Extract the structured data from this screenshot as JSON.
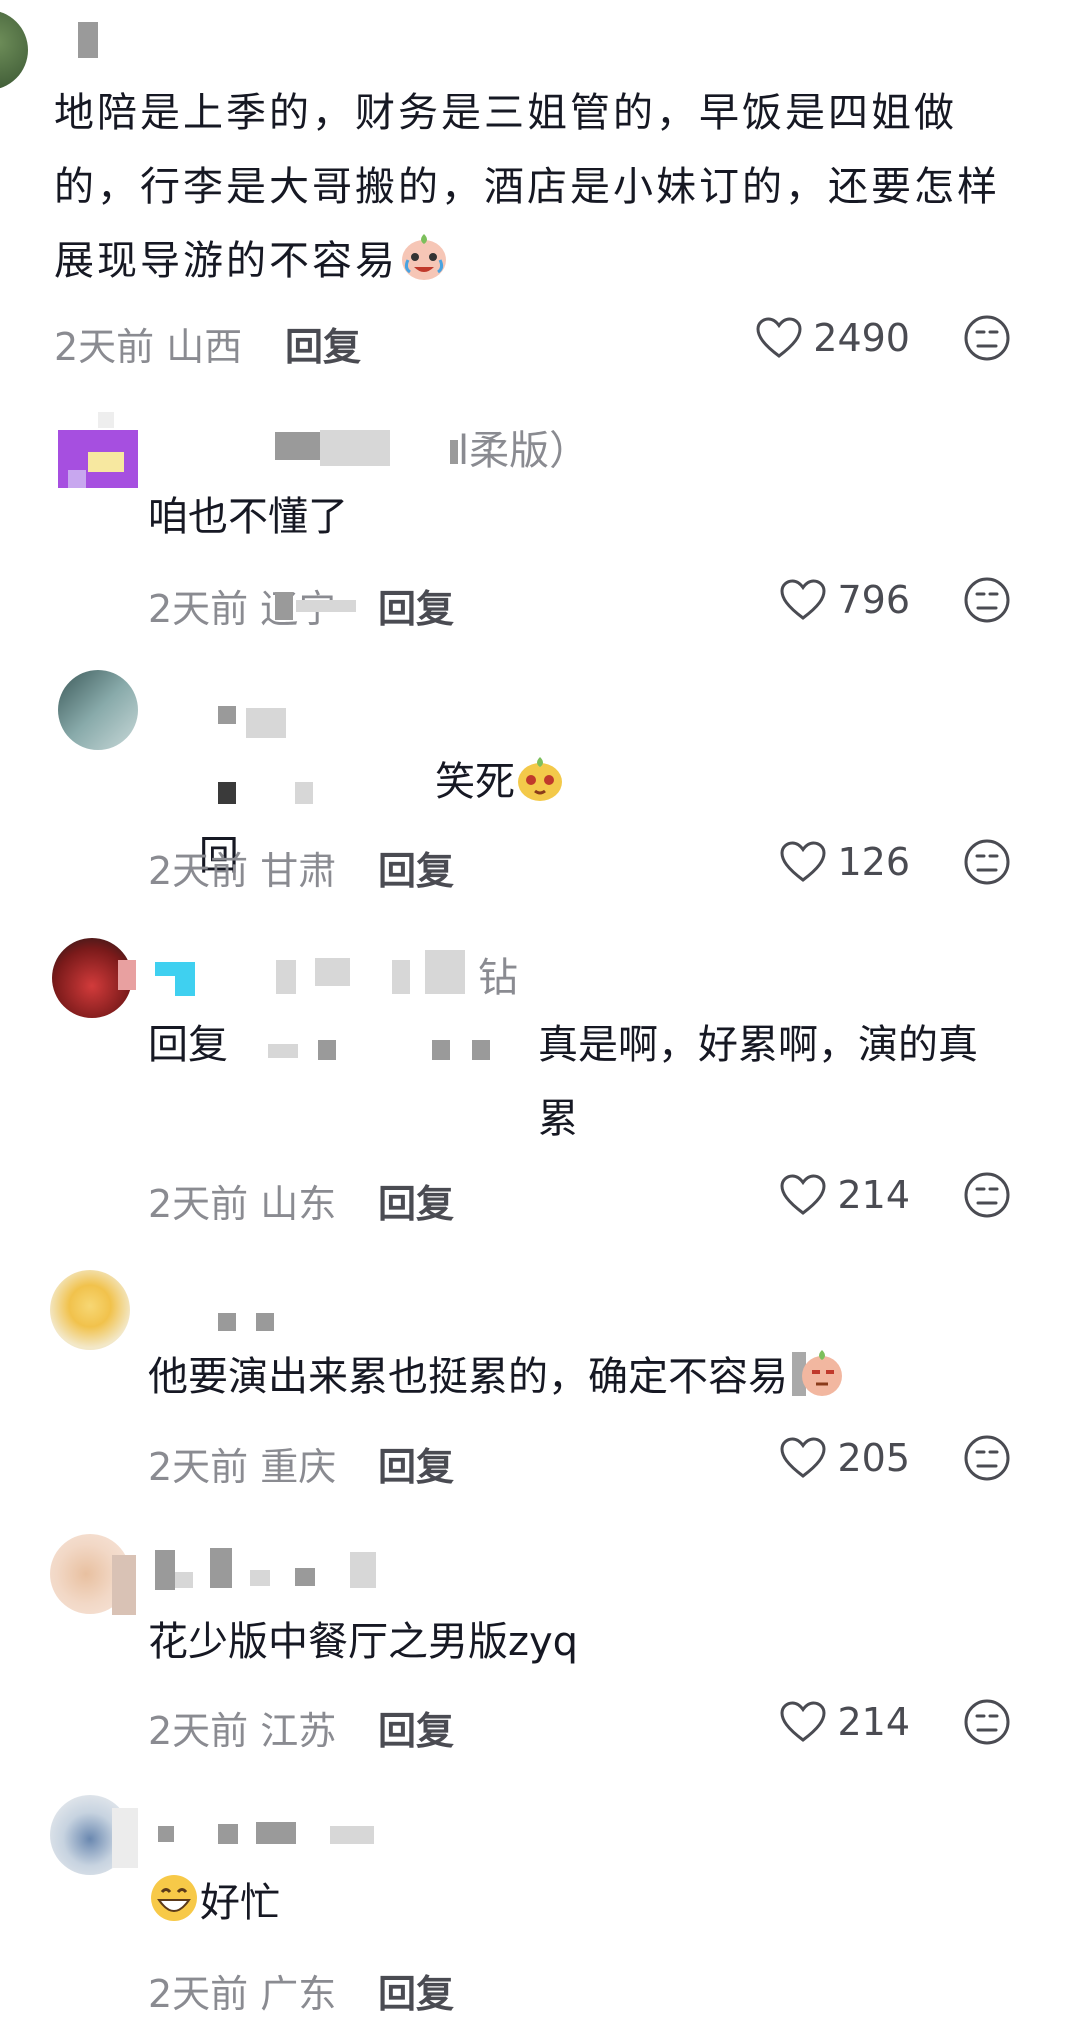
{
  "comments": [
    {
      "text": "地陪是上季的，财务是三姐管的，早饭是四姐做的，行李是大哥搬的，酒店是小妹订的，还要怎样展现导游的不容易",
      "time": "2天前 山西",
      "reply": "回复",
      "likes": "2490"
    },
    {
      "name_suffix": "l柔版）",
      "text": "咱也不懂了",
      "time": "2天前 辽宁",
      "reply": "回复",
      "likes": "796"
    },
    {
      "text_prefix": "回",
      "text": "笑死",
      "time": "2天前 甘肃",
      "reply": "回复",
      "likes": "126"
    },
    {
      "name_suffix": "钻",
      "text_prefix": "回复",
      "text": "真是啊，好累啊，演的真累",
      "time": "2天前 山东",
      "reply": "回复",
      "likes": "214"
    },
    {
      "text": "他要演出来累也挺累的，确定不容易",
      "time": "2天前 重庆",
      "reply": "回复",
      "likes": "205"
    },
    {
      "text": "花少版中餐厅之男版zyq",
      "time": "2天前 江苏",
      "reply": "回复",
      "likes": "214"
    },
    {
      "text": "好忙",
      "time": "2天前 广东",
      "reply": "回复"
    }
  ],
  "colors": {
    "text": "#161823",
    "meta": "#8a8b91",
    "icon": "#4a4b52"
  },
  "icons": {
    "like": "heart-outline-icon",
    "dislike": "neutral-face-icon"
  }
}
